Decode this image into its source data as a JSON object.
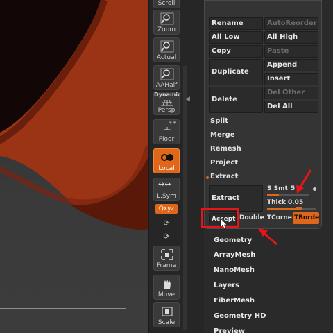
{
  "shelf": {
    "scroll": "Scroll",
    "zoom": "Zoom",
    "actual": "Actual",
    "aahalf": "AAHalf",
    "dynamic": "Dynamic",
    "persp": "Persp",
    "floor": "Floor",
    "local": "Local",
    "lsym": "L.Sym",
    "xyz": "Qxyz",
    "frame": "Frame",
    "move": "Move",
    "scale": "Scale"
  },
  "panel": {
    "rename": "Rename",
    "autoreorder": "AutoReorder",
    "all_low": "All Low",
    "all_high": "All High",
    "copy": "Copy",
    "paste": "Paste",
    "duplicate": "Duplicate",
    "append": "Append",
    "insert": "Insert",
    "delete": "Delete",
    "del_other": "Del Other",
    "del_all": "Del All",
    "split": "Split",
    "merge": "Merge",
    "remesh": "Remesh",
    "project": "Project",
    "extract_header": "Extract",
    "extract_btn": "Extract",
    "s_smt_label": "S Smt",
    "s_smt_value": "5",
    "thick_label": "Thick",
    "thick_value": "0.05",
    "s_smt_fraction": 0.2,
    "thick_fraction": 0.65,
    "accept": "Accept",
    "double": "Double",
    "tcorner": "TCorne",
    "tborder": "TBorde"
  },
  "list": [
    "Geometry",
    "ArrayMesh",
    "NanoMesh",
    "Layers",
    "FiberMesh",
    "Geometry HD",
    "Preview"
  ],
  "colors": {
    "accent": "#e0661a",
    "annotation": "#e8141a",
    "mesh": "#8a2a10"
  }
}
